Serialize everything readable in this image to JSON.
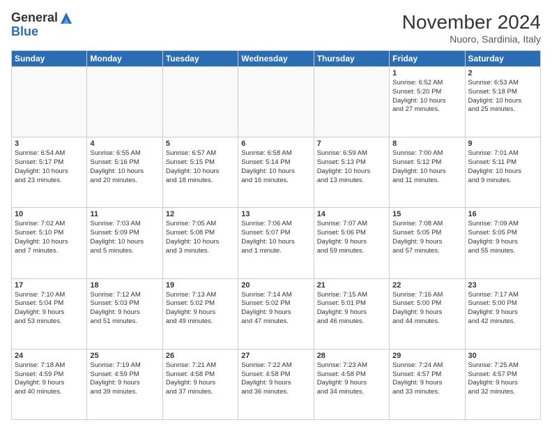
{
  "logo": {
    "general": "General",
    "blue": "Blue"
  },
  "header": {
    "month": "November 2024",
    "location": "Nuoro, Sardinia, Italy"
  },
  "weekdays": [
    "Sunday",
    "Monday",
    "Tuesday",
    "Wednesday",
    "Thursday",
    "Friday",
    "Saturday"
  ],
  "weeks": [
    [
      {
        "day": "",
        "info": ""
      },
      {
        "day": "",
        "info": ""
      },
      {
        "day": "",
        "info": ""
      },
      {
        "day": "",
        "info": ""
      },
      {
        "day": "",
        "info": ""
      },
      {
        "day": "1",
        "info": "Sunrise: 6:52 AM\nSunset: 5:20 PM\nDaylight: 10 hours\nand 27 minutes."
      },
      {
        "day": "2",
        "info": "Sunrise: 6:53 AM\nSunset: 5:18 PM\nDaylight: 10 hours\nand 25 minutes."
      }
    ],
    [
      {
        "day": "3",
        "info": "Sunrise: 6:54 AM\nSunset: 5:17 PM\nDaylight: 10 hours\nand 23 minutes."
      },
      {
        "day": "4",
        "info": "Sunrise: 6:55 AM\nSunset: 5:16 PM\nDaylight: 10 hours\nand 20 minutes."
      },
      {
        "day": "5",
        "info": "Sunrise: 6:57 AM\nSunset: 5:15 PM\nDaylight: 10 hours\nand 18 minutes."
      },
      {
        "day": "6",
        "info": "Sunrise: 6:58 AM\nSunset: 5:14 PM\nDaylight: 10 hours\nand 16 minutes."
      },
      {
        "day": "7",
        "info": "Sunrise: 6:59 AM\nSunset: 5:13 PM\nDaylight: 10 hours\nand 13 minutes."
      },
      {
        "day": "8",
        "info": "Sunrise: 7:00 AM\nSunset: 5:12 PM\nDaylight: 10 hours\nand 11 minutes."
      },
      {
        "day": "9",
        "info": "Sunrise: 7:01 AM\nSunset: 5:11 PM\nDaylight: 10 hours\nand 9 minutes."
      }
    ],
    [
      {
        "day": "10",
        "info": "Sunrise: 7:02 AM\nSunset: 5:10 PM\nDaylight: 10 hours\nand 7 minutes."
      },
      {
        "day": "11",
        "info": "Sunrise: 7:03 AM\nSunset: 5:09 PM\nDaylight: 10 hours\nand 5 minutes."
      },
      {
        "day": "12",
        "info": "Sunrise: 7:05 AM\nSunset: 5:08 PM\nDaylight: 10 hours\nand 3 minutes."
      },
      {
        "day": "13",
        "info": "Sunrise: 7:06 AM\nSunset: 5:07 PM\nDaylight: 10 hours\nand 1 minute."
      },
      {
        "day": "14",
        "info": "Sunrise: 7:07 AM\nSunset: 5:06 PM\nDaylight: 9 hours\nand 59 minutes."
      },
      {
        "day": "15",
        "info": "Sunrise: 7:08 AM\nSunset: 5:05 PM\nDaylight: 9 hours\nand 57 minutes."
      },
      {
        "day": "16",
        "info": "Sunrise: 7:09 AM\nSunset: 5:05 PM\nDaylight: 9 hours\nand 55 minutes."
      }
    ],
    [
      {
        "day": "17",
        "info": "Sunrise: 7:10 AM\nSunset: 5:04 PM\nDaylight: 9 hours\nand 53 minutes."
      },
      {
        "day": "18",
        "info": "Sunrise: 7:12 AM\nSunset: 5:03 PM\nDaylight: 9 hours\nand 51 minutes."
      },
      {
        "day": "19",
        "info": "Sunrise: 7:13 AM\nSunset: 5:02 PM\nDaylight: 9 hours\nand 49 minutes."
      },
      {
        "day": "20",
        "info": "Sunrise: 7:14 AM\nSunset: 5:02 PM\nDaylight: 9 hours\nand 47 minutes."
      },
      {
        "day": "21",
        "info": "Sunrise: 7:15 AM\nSunset: 5:01 PM\nDaylight: 9 hours\nand 46 minutes."
      },
      {
        "day": "22",
        "info": "Sunrise: 7:16 AM\nSunset: 5:00 PM\nDaylight: 9 hours\nand 44 minutes."
      },
      {
        "day": "23",
        "info": "Sunrise: 7:17 AM\nSunset: 5:00 PM\nDaylight: 9 hours\nand 42 minutes."
      }
    ],
    [
      {
        "day": "24",
        "info": "Sunrise: 7:18 AM\nSunset: 4:59 PM\nDaylight: 9 hours\nand 40 minutes."
      },
      {
        "day": "25",
        "info": "Sunrise: 7:19 AM\nSunset: 4:59 PM\nDaylight: 9 hours\nand 39 minutes."
      },
      {
        "day": "26",
        "info": "Sunrise: 7:21 AM\nSunset: 4:58 PM\nDaylight: 9 hours\nand 37 minutes."
      },
      {
        "day": "27",
        "info": "Sunrise: 7:22 AM\nSunset: 4:58 PM\nDaylight: 9 hours\nand 36 minutes."
      },
      {
        "day": "28",
        "info": "Sunrise: 7:23 AM\nSunset: 4:58 PM\nDaylight: 9 hours\nand 34 minutes."
      },
      {
        "day": "29",
        "info": "Sunrise: 7:24 AM\nSunset: 4:57 PM\nDaylight: 9 hours\nand 33 minutes."
      },
      {
        "day": "30",
        "info": "Sunrise: 7:25 AM\nSunset: 4:57 PM\nDaylight: 9 hours\nand 32 minutes."
      }
    ]
  ]
}
